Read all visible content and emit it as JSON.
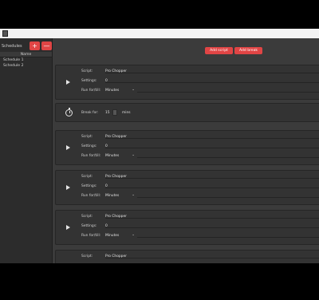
{
  "sidebar": {
    "title": "Schedules",
    "add_label": "+",
    "remove_label": "—",
    "column_header": "Name",
    "items": [
      {
        "label": "Schedule 1"
      },
      {
        "label": "Schedule 2"
      }
    ]
  },
  "toolbar": {
    "add_script_label": "Add script",
    "add_break_label": "Add break"
  },
  "entries": [
    {
      "type": "script",
      "script_label": "Script:",
      "script_value": "Pro Chopper",
      "settings_label": "Settings:",
      "settings_value": "0",
      "run_label": "Run for/till:",
      "run_value": "Minutes"
    },
    {
      "type": "break",
      "break_label": "Break for:",
      "break_value": "15",
      "unit": "mins"
    },
    {
      "type": "script",
      "script_label": "Script:",
      "script_value": "Pro Chopper",
      "settings_label": "Settings:",
      "settings_value": "0",
      "run_label": "Run for/till:",
      "run_value": "Minutes"
    },
    {
      "type": "script",
      "script_label": "Script:",
      "script_value": "Pro Chopper",
      "settings_label": "Settings:",
      "settings_value": "0",
      "run_label": "Run for/till:",
      "run_value": "Minutes"
    },
    {
      "type": "script",
      "script_label": "Script:",
      "script_value": "Pro Chopper",
      "settings_label": "Settings:",
      "settings_value": "0",
      "run_label": "Run for/till:",
      "run_value": "Minutes"
    },
    {
      "type": "script",
      "script_label": "Script:",
      "script_value": "Pro Chopper"
    }
  ],
  "colors": {
    "accent": "#e04545",
    "background": "#3b3b3b",
    "panel": "#333333",
    "sidebar": "#2c2c2c"
  },
  "icons": {
    "play": "play-icon",
    "timer": "stopwatch-icon",
    "dropdown": "chevron-down-icon"
  }
}
